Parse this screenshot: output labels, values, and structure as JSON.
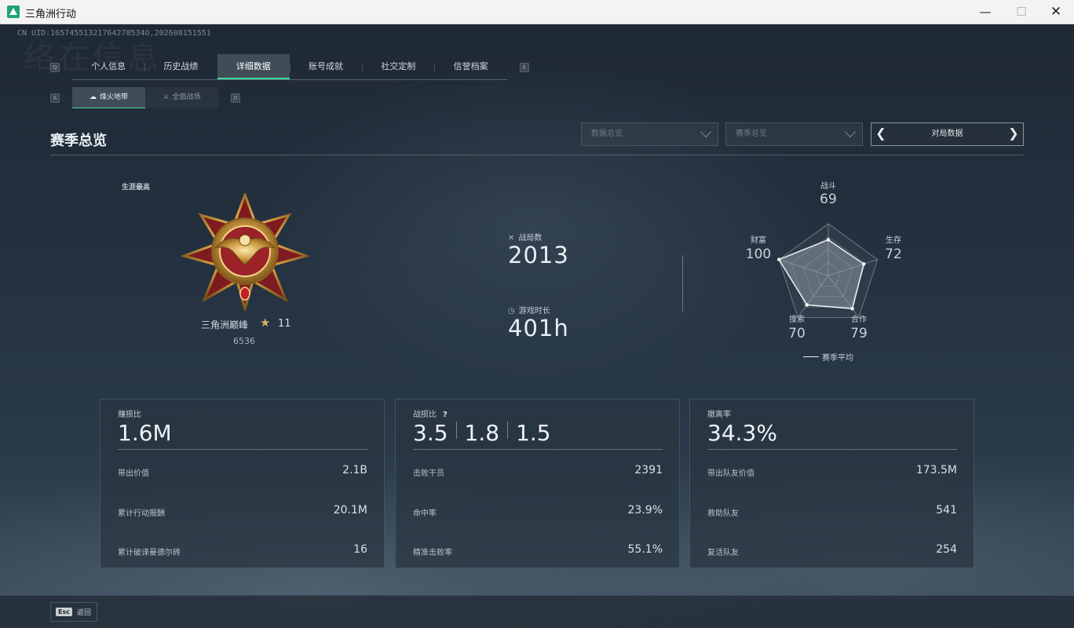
{
  "window": {
    "title": "三角洲行动",
    "min": "—",
    "max": "☐",
    "close": "✕"
  },
  "header": {
    "uid": "CN UID:16574551321764278534O,202608151551",
    "ghost_title": "络在信息",
    "key_left": "Q",
    "key_right": "E",
    "sub_key_left": "A",
    "sub_key_right": "D"
  },
  "tabs": [
    "个人信息",
    "历史战绩",
    "详细数据",
    "账号成就",
    "社交定制",
    "信誉档案"
  ],
  "subtabs": [
    {
      "label": "烽火地带",
      "icon": "☁"
    },
    {
      "label": "全面战场",
      "icon": "⚔"
    }
  ],
  "section_title": "赛季总览",
  "filters": {
    "data_overview": "数据总览",
    "season_overview": "赛季总览",
    "match_data": "对局数据",
    "prev": "❮",
    "next": "❯"
  },
  "career": {
    "label": "生涯最高",
    "rank_name": "三角洲巅峰",
    "star": "★",
    "level": "11",
    "score": "6536"
  },
  "stats": {
    "matches_label": "战局数",
    "matches_icon": "✕",
    "matches": "2013",
    "playtime_label": "游戏时长",
    "playtime_icon": "◷",
    "playtime": "401h"
  },
  "radar": {
    "axes": [
      {
        "label": "战斗",
        "value": 69
      },
      {
        "label": "生存",
        "value": 72
      },
      {
        "label": "合作",
        "value": 79
      },
      {
        "label": "搜索",
        "value": 70
      },
      {
        "label": "财富",
        "value": 100
      }
    ],
    "legend": "赛季平均",
    "max": 100
  },
  "cards": [
    {
      "label": "赚损比",
      "big": "1.6M",
      "rows": [
        {
          "k": "带出价值",
          "v": "2.1B"
        },
        {
          "k": "累计行动报酬",
          "v": "20.1M"
        },
        {
          "k": "累计破译曼德尔砖",
          "v": "16"
        }
      ]
    },
    {
      "label": "战损比",
      "help": "?",
      "ratios": [
        "3.5",
        "1.8",
        "1.5"
      ],
      "rows": [
        {
          "k": "击败干员",
          "v": "2391"
        },
        {
          "k": "命中率",
          "v": "23.9%"
        },
        {
          "k": "精准击败率",
          "v": "55.1%"
        }
      ]
    },
    {
      "label": "撤离率",
      "big": "34.3%",
      "rows": [
        {
          "k": "带出队友价值",
          "v": "173.5M"
        },
        {
          "k": "救助队友",
          "v": "541"
        },
        {
          "k": "复活队友",
          "v": "254"
        }
      ]
    }
  ],
  "footer": {
    "esc_key": "Esc",
    "back": "返回"
  },
  "colors": {
    "accent": "#3fd89a",
    "star": "#d8b462"
  }
}
